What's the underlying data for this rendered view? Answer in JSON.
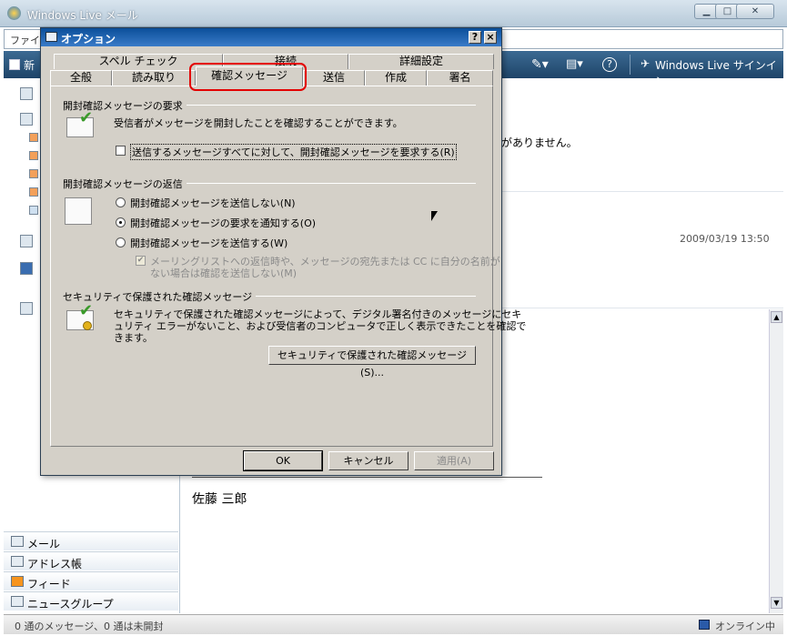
{
  "main_window": {
    "title": "Windows Live メール",
    "menu_first": "ファイル",
    "toolbar_new": "新",
    "toolbar_signin": "Windows Live サインイン",
    "message_text": "がありません。",
    "date": "2009/03/19 13:50",
    "signature": "佐藤 三郎",
    "nav": [
      {
        "label": "メール"
      },
      {
        "label": "アドレス帳"
      },
      {
        "label": "フィード"
      },
      {
        "label": "ニュースグループ"
      }
    ],
    "status_left": "0 通のメッセージ、0 通は未開封",
    "status_right": "オンライン中"
  },
  "dialog": {
    "title": "オプション",
    "help_btn": "?",
    "close_btn": "×",
    "tabs_row1": [
      "スペル チェック",
      "接続",
      "詳細設定"
    ],
    "tabs_row2": [
      "全般",
      "読み取り",
      "確認メッセージ",
      "送信",
      "作成",
      "署名"
    ],
    "section1": {
      "title": "開封確認メッセージの要求",
      "desc": "受信者がメッセージを開封したことを確認することができます。",
      "checkbox": "送信するメッセージすべてに対して、開封確認メッセージを要求する(R)"
    },
    "section2": {
      "title": "開封確認メッセージの返信",
      "radio1": "開封確認メッセージを送信しない(N)",
      "radio2": "開封確認メッセージの要求を通知する(O)",
      "radio3": "開封確認メッセージを送信する(W)",
      "sub_line1": "メーリングリストへの返信時や、メッセージの宛先または CC に自分の名前が",
      "sub_line2": "ない場合は確認を送信しない(M)"
    },
    "section3": {
      "title": "セキュリティで保護された確認メッセージ",
      "line1": "セキュリティで保護された確認メッセージによって、デジタル署名付きのメッセージにセキ",
      "line2": "ュリティ エラーがないこと、および受信者のコンピュータで正しく表示できたことを確認で",
      "line3": "きます。",
      "button": "セキュリティで保護された確認メッセージ(S)..."
    },
    "ok": "OK",
    "cancel": "キャンセル",
    "apply": "適用(A)"
  }
}
